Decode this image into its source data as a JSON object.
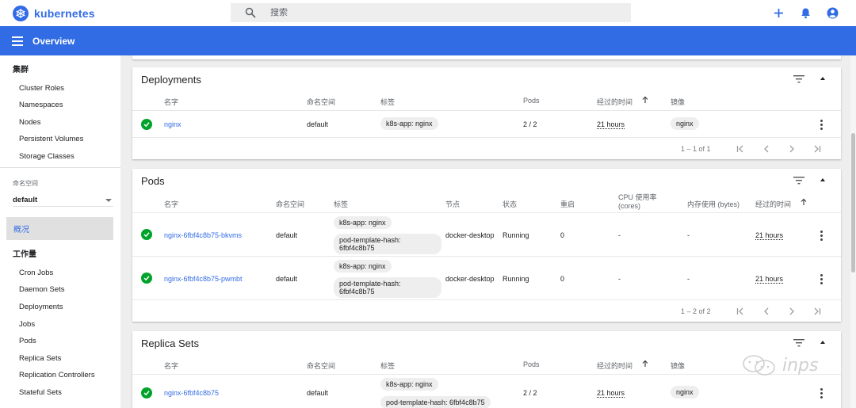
{
  "app": {
    "brand": "kubernetes",
    "search_placeholder": "搜索",
    "page_title": "Overview"
  },
  "colors": {
    "brand": "#326ce5",
    "ok": "#00a32a",
    "background": "#eeeeee"
  },
  "icons": {
    "add": "plus-icon",
    "notifications": "bell-icon",
    "account": "account-circle-icon"
  },
  "sidebar": {
    "cluster_heading": "集群",
    "cluster_items": [
      "Cluster Roles",
      "Namespaces",
      "Nodes",
      "Persistent Volumes",
      "Storage Classes"
    ],
    "namespace_label": "命名空间",
    "namespace_value": "default",
    "overview_label": "概况",
    "workloads_heading": "工作量",
    "workload_items": [
      "Cron Jobs",
      "Daemon Sets",
      "Deployments",
      "Jobs",
      "Pods",
      "Replica Sets",
      "Replication Controllers",
      "Stateful Sets"
    ]
  },
  "deployments": {
    "title": "Deployments",
    "headers": {
      "name": "名字",
      "namespace": "命名空间",
      "labels": "标签",
      "pods": "Pods",
      "age": "经过的时间",
      "images": "镜像"
    },
    "rows": [
      {
        "name": "nginx",
        "namespace": "default",
        "labels": [
          "k8s-app: nginx"
        ],
        "pods": "2 / 2",
        "age": "21 hours",
        "image": "nginx"
      }
    ],
    "pager": "1 – 1 of 1"
  },
  "pods": {
    "title": "Pods",
    "headers": {
      "name": "名字",
      "namespace": "命名空间",
      "labels": "标签",
      "node": "节点",
      "status": "状态",
      "restarts": "重启",
      "cpu": "CPU 使用率 (cores)",
      "memory": "内存使用 (bytes)",
      "age": "经过的时间"
    },
    "rows": [
      {
        "name": "nginx-6fbf4c8b75-bkvms",
        "namespace": "default",
        "labels": [
          "k8s-app: nginx",
          "pod-template-hash: 6fbf4c8b75"
        ],
        "node": "docker-desktop",
        "status": "Running",
        "restarts": "0",
        "cpu": "-",
        "memory": "-",
        "age": "21 hours"
      },
      {
        "name": "nginx-6fbf4c8b75-pwmbt",
        "namespace": "default",
        "labels": [
          "k8s-app: nginx",
          "pod-template-hash: 6fbf4c8b75"
        ],
        "node": "docker-desktop",
        "status": "Running",
        "restarts": "0",
        "cpu": "-",
        "memory": "-",
        "age": "21 hours"
      }
    ],
    "pager": "1 – 2 of 2"
  },
  "replicasets": {
    "title": "Replica Sets",
    "headers": {
      "name": "名字",
      "namespace": "命名空间",
      "labels": "标签",
      "pods": "Pods",
      "age": "经过的时间",
      "images": "镜像"
    },
    "rows": [
      {
        "name": "nginx-6fbf4c8b75",
        "namespace": "default",
        "labels": [
          "k8s-app: nginx",
          "pod-template-hash: 6fbf4c8b75"
        ],
        "pods": "2 / 2",
        "age": "21 hours",
        "image": "nginx"
      }
    ]
  },
  "watermark": "inps"
}
